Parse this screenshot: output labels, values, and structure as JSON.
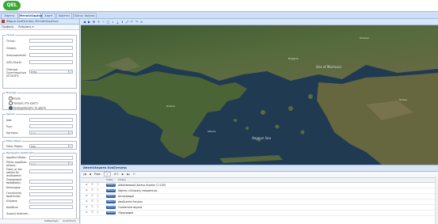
{
  "app": {
    "logo_text": "QEL"
  },
  "tabs": [
    {
      "label": "Χάρτης",
      "active": false
    },
    {
      "label": "Μεταδεδομένα",
      "active": true
    },
    {
      "label": "Χαρτί",
      "active": false
    },
    {
      "label": "Χρήστες",
      "active": false
    },
    {
      "label": "Άδειες Χρήσης",
      "active": false
    }
  ],
  "left_panel": {
    "title": "Φόρμα Αναζήτησης Μεταδεδομένων",
    "toolbar": {
      "search_label": "Προβολή",
      "results_label": "Ρυθμίσεις ▾"
    },
    "fieldset_info": {
      "legend": "Γενικά",
      "title_label": "Τίτλος:",
      "abstract_label": "Σύνοψη:",
      "identifier_label": "Αναγνωριστικό:",
      "keywords_label": "Λέξη Κλειδί:",
      "crs_label": "Σύστημα Συντεταγμένων (ΕΓΣΑ'87):",
      "crs_value": "ΕΓΣΑ"
    },
    "fieldset_area": {
      "legend": "Περιοχή",
      "radios": [
        {
          "label": "Καμία",
          "checked": false
        },
        {
          "label": "Ορισμός στο χάρτη",
          "checked": false
        },
        {
          "label": "Χρησιμοποιήστε το χάρτη",
          "checked": true
        }
      ]
    },
    "fieldset_time": {
      "legend": "Χρόνος",
      "from_label": "Από:",
      "to_label": "Έως:",
      "criteria_label": "Κριτήριο:",
      "criteria_value": "Όλα"
    },
    "fieldset_type": {
      "legend": "Είδος Πόρου",
      "type_label": "Είδος Πόρου:",
      "type_value": "Όλα"
    },
    "fieldset_advanced": {
      "legend": "Προηγμένη Αναζήτηση",
      "fields": [
        {
          "label": "Αρμόδιο Μέρος:",
          "value": ""
        },
        {
          "label": "Ρόλος αρμόδιου μέρους:",
          "value": "Όλα"
        },
        {
          "label": "Όρος με τον οποίον θα συνδυαστεί:",
          "value": ""
        },
        {
          "label": "Περιορισμοί πρόσβασης:",
          "value": ""
        },
        {
          "label": "Κατηγορία:",
          "value": ""
        },
        {
          "label": "Γενεαλογία/προέλευση:",
          "value": ""
        },
        {
          "label": "Κλίμακα:",
          "value": ""
        },
        {
          "label": "Ακρίβεια:",
          "value": ""
        }
      ],
      "trailing_label": "Χωρική Ανάλυση:"
    },
    "footer": {
      "clear_label": "Καθαρισμός",
      "search_label": "Αναζήτηση"
    }
  },
  "map_labels": [
    {
      "text": "Ukraine"
    },
    {
      "text": "Bulgaria"
    },
    {
      "text": "Sea of Marmara"
    },
    {
      "text": "Turkey"
    },
    {
      "text": "Greece"
    },
    {
      "text": "Aegean Sea"
    },
    {
      "text": "Athens"
    }
  ],
  "results": {
    "title": "Αποτελέσματα Αναζήτησης",
    "pager": {
      "page_label": "Page",
      "page_value": "1",
      "of_label": "of 1"
    },
    "columns": {
      "type": "Τύπος",
      "title": "Τίτλος"
    },
    "rows": [
      {
        "badge": "dataset",
        "title": "Διθαλασσιακό Δίκτυο Αιγαίου (1:100)"
      },
      {
        "badge": "dataset",
        "title": "Χάρτης ελληνικής επικράτειας"
      },
      {
        "badge": "dataset",
        "title": "Ακτογραμμή"
      },
      {
        "badge": "dataset",
        "title": "Αποδεκτέα Κτηνίου"
      },
      {
        "badge": "dataset",
        "title": "Γεωδαιτικά σημεία"
      },
      {
        "badge": "dataset",
        "title": "Υδρογραφία"
      }
    ]
  }
}
